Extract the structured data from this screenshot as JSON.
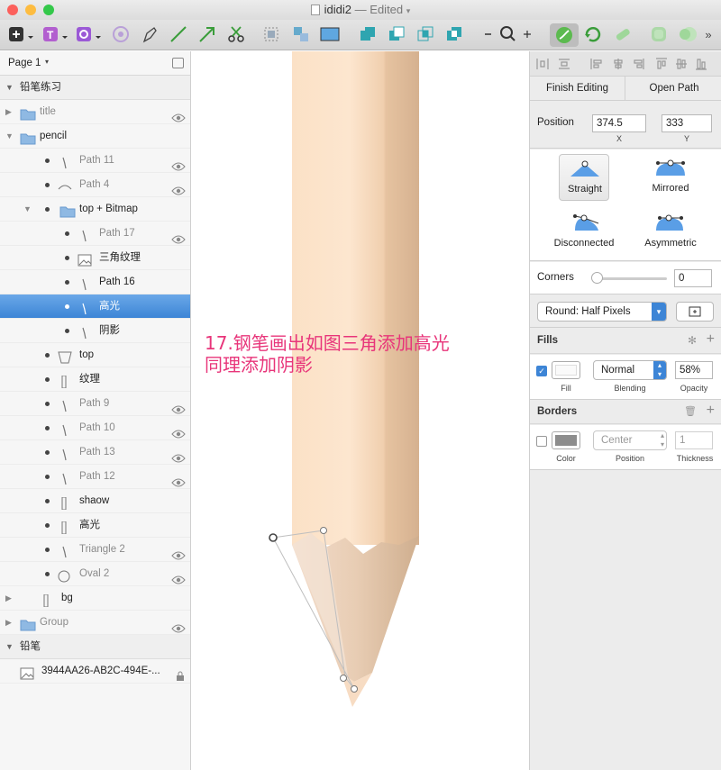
{
  "window": {
    "filename": "ididi2",
    "status": "Edited"
  },
  "pages": {
    "current": "Page 1"
  },
  "layers": [
    {
      "name": "铅笔练习",
      "kind": "artboard",
      "dim": false
    },
    {
      "name": "title",
      "kind": "group",
      "dim": true,
      "eye": true
    },
    {
      "name": "pencil",
      "kind": "group-open",
      "dim": false
    },
    {
      "name": "Path 11",
      "kind": "path",
      "dim": true,
      "eye": true
    },
    {
      "name": "Path 4",
      "kind": "path",
      "dim": true,
      "eye": true
    },
    {
      "name": "top + Bitmap",
      "kind": "group-open",
      "dim": false
    },
    {
      "name": "Path 17",
      "kind": "path",
      "dim": true,
      "eye": true
    },
    {
      "name": "三角纹理",
      "kind": "image",
      "dim": false
    },
    {
      "name": "Path 16",
      "kind": "path",
      "dim": false
    },
    {
      "name": "高光",
      "kind": "path",
      "dim": false,
      "selected": true
    },
    {
      "name": "阴影",
      "kind": "path",
      "dim": false
    },
    {
      "name": "top",
      "kind": "shape",
      "dim": false
    },
    {
      "name": "纹理",
      "kind": "rect",
      "dim": false
    },
    {
      "name": "Path 9",
      "kind": "path",
      "dim": true,
      "eye": true
    },
    {
      "name": "Path 10",
      "kind": "path",
      "dim": true,
      "eye": true
    },
    {
      "name": "Path 13",
      "kind": "path",
      "dim": true,
      "eye": true
    },
    {
      "name": "Path 12",
      "kind": "path",
      "dim": true,
      "eye": true
    },
    {
      "name": "shaow",
      "kind": "rect",
      "dim": false
    },
    {
      "name": "高光",
      "kind": "rect",
      "dim": false
    },
    {
      "name": "Triangle 2",
      "kind": "path",
      "dim": true,
      "eye": true
    },
    {
      "name": "Oval 2",
      "kind": "oval",
      "dim": true,
      "eye": true
    },
    {
      "name": "bg",
      "kind": "rect",
      "dim": false
    },
    {
      "name": "Group",
      "kind": "group",
      "dim": true,
      "eye": true
    },
    {
      "name": "铅笔",
      "kind": "artboard",
      "dim": false
    },
    {
      "name": "3944AA26-AB2C-494E-...",
      "kind": "image",
      "dim": false,
      "lock": true
    }
  ],
  "annotation": {
    "line1": "17.钢笔画出如图三角添加高光",
    "line2": "同理添加阴影",
    "color": "#e8357a"
  },
  "inspector": {
    "finish_editing": "Finish Editing",
    "open_path": "Open Path",
    "position_label": "Position",
    "x_value": "374.5",
    "y_value": "333",
    "x_caption": "X",
    "y_caption": "Y",
    "point_types": [
      "Straight",
      "Mirrored",
      "Disconnected",
      "Asymmetric"
    ],
    "corners_label": "Corners",
    "corners_value": "0",
    "round_option": "Round: Half Pixels",
    "fills_title": "Fills",
    "fill_caption": "Fill",
    "blending_value": "Normal",
    "blending_caption": "Blending",
    "opacity_value": "58%",
    "opacity_caption": "Opacity",
    "borders_title": "Borders",
    "color_caption": "Color",
    "position_value": "Center",
    "position_caption": "Position",
    "thickness_value": "1",
    "thickness_caption": "Thickness"
  },
  "colors": {
    "accent": "#3d85d6",
    "pencil_light": "#fde3c8",
    "pencil_dark": "#d9b593"
  }
}
